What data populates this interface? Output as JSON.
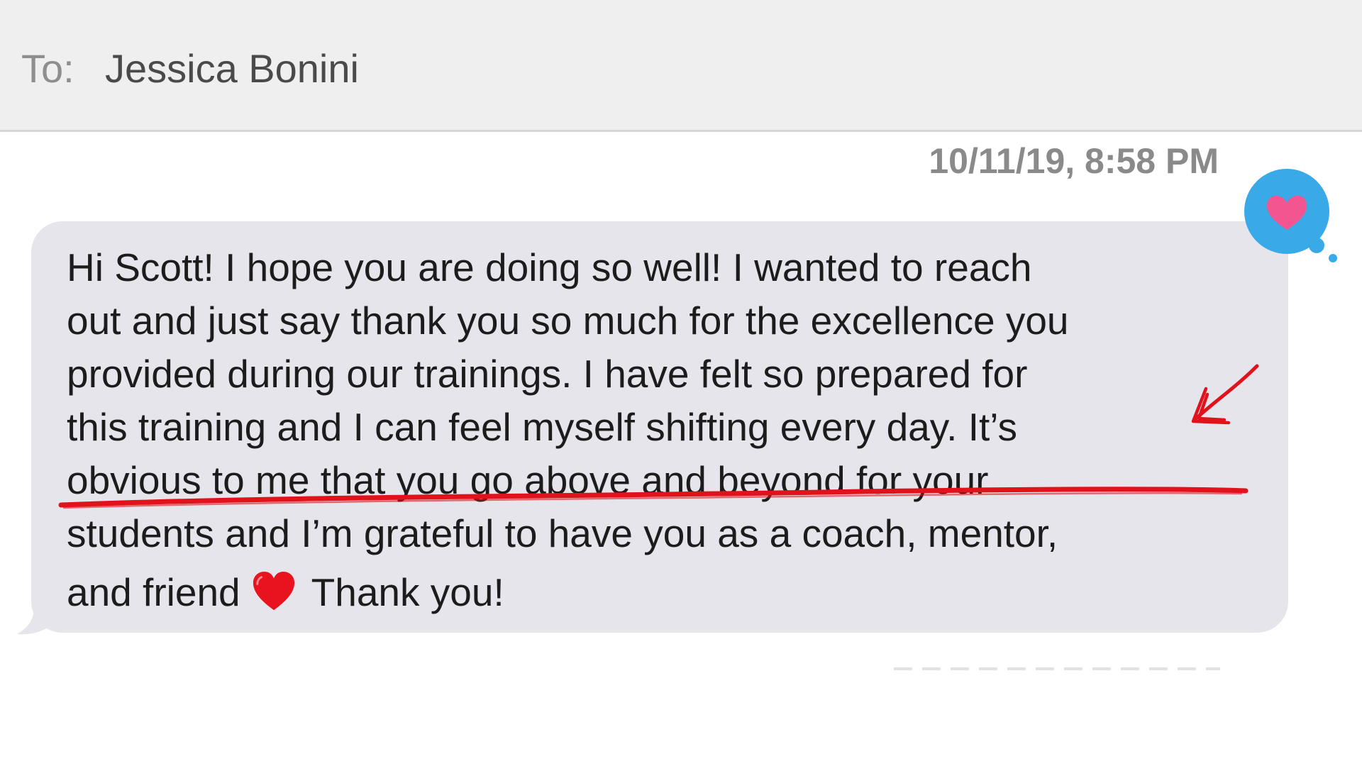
{
  "header": {
    "to_label": "To:",
    "recipient": "Jessica Bonini"
  },
  "message": {
    "timestamp": "10/11/19, 8:58 PM",
    "lines": [
      "Hi Scott! I hope you are doing so well! I wanted to reach",
      "out and just say thank you so much for the excellence you",
      "provided during our trainings. I have felt so prepared for",
      "this training and I can feel myself shifting every day. It’s",
      "obvious to me that you go above and beyond for your",
      "students and I’m grateful to have you as a coach, mentor,"
    ],
    "last_line_before_emoji": "and friend",
    "emoji": "red-heart-emoji",
    "last_line_after_emoji": "Thank you!",
    "tapback": "heart-icon"
  },
  "colors": {
    "header_bg": "#efefef",
    "bubble_bg": "#e6e5eb",
    "tapback_blue": "#39a9e8",
    "tapback_heart": "#f2558f",
    "annotation_red": "#e0121b"
  }
}
